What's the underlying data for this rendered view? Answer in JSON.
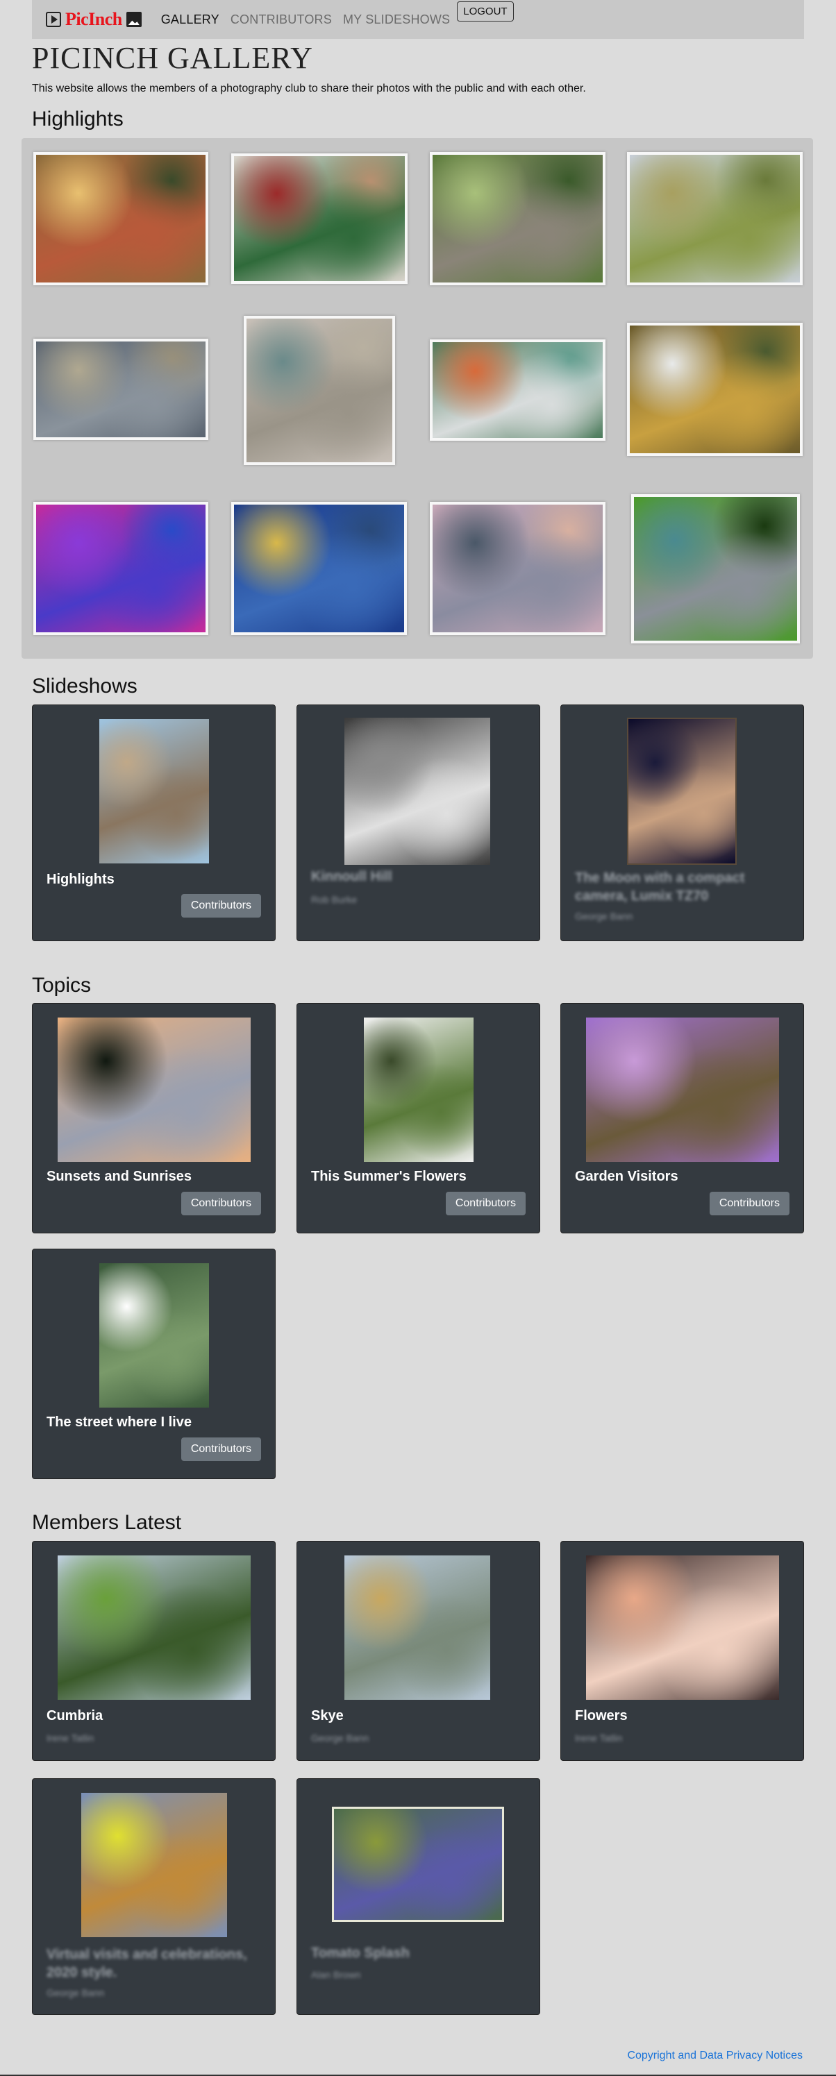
{
  "nav": {
    "brand": "PicInch",
    "links": [
      "GALLERY",
      "CONTRIBUTORS",
      "MY SLIDESHOWS"
    ],
    "logout": "LOGOUT"
  },
  "site": {
    "title": "PICINCH GALLERY",
    "intro": "This website allows the members of a photography club to share their photos with the public and with each other."
  },
  "sections": {
    "highlights": "Highlights",
    "slideshows": "Slideshows",
    "topics": "Topics",
    "members_latest": "Members Latest"
  },
  "highlights": [
    {
      "name": "steam-train-forest-photo",
      "colors": [
        "#8a6a3a",
        "#b85a3a",
        "#e8c070",
        "#3a4a2a"
      ]
    },
    {
      "name": "green-steam-locomotive-photo",
      "colors": [
        "#d9d4cc",
        "#2f6a3a",
        "#9c2a2a",
        "#b89070"
      ]
    },
    {
      "name": "stone-viaduct-photo",
      "colors": [
        "#5a7a3a",
        "#8a8478",
        "#a8c07a",
        "#3a5a2a"
      ]
    },
    {
      "name": "green-valley-rainbow-photo",
      "colors": [
        "#c8cfd8",
        "#8a9a4a",
        "#a8a060",
        "#6a7a3a"
      ]
    },
    {
      "name": "beach-storm-sky-photo",
      "colors": [
        "#5a6470",
        "#8a939c",
        "#b0a890",
        "#9a9078"
      ]
    },
    {
      "name": "concrete-dome-columns-photo",
      "colors": [
        "#c8c0b8",
        "#9a9488",
        "#6a8a8a",
        "#b8b0a0"
      ]
    },
    {
      "name": "pool-floats-photo",
      "colors": [
        "#4a7a5a",
        "#d8dcdc",
        "#d86a3a",
        "#5a9a8a"
      ]
    },
    {
      "name": "waterfall-autumn-photo",
      "colors": [
        "#6a5a2a",
        "#c8a040",
        "#e8eaea",
        "#4a5a30"
      ]
    },
    {
      "name": "pink-purple-bubbles-photo",
      "colors": [
        "#c82a9a",
        "#4a3ac8",
        "#8a3ad8",
        "#2a4ac8"
      ]
    },
    {
      "name": "blue-lake-reflection-photo",
      "colors": [
        "#1a3a8a",
        "#3a6ab8",
        "#d8b84a",
        "#2a4a7a"
      ]
    },
    {
      "name": "dusk-river-bridge-photo",
      "colors": [
        "#c8a8b8",
        "#8a8ca0",
        "#4a5868",
        "#d8b0a0"
      ]
    },
    {
      "name": "green-leaf-grey-door-photo",
      "colors": [
        "#4a9a2a",
        "#8a9098",
        "#4a8a90",
        "#1a3a10"
      ]
    }
  ],
  "slideshows": [
    {
      "title": "Highlights",
      "subtitle": "",
      "button": "Contributors",
      "blurred": false,
      "colors": [
        "#9fc4e0",
        "#8a7660",
        "#c0a888"
      ]
    },
    {
      "title": "Kinnoull Hill",
      "subtitle": "Rob Burke",
      "button": "",
      "blurred": true,
      "colors": [
        "#3a3a3a",
        "#e0e0e0",
        "#8a8a8a"
      ]
    },
    {
      "title": "The Moon with a compact camera, Lumix TZ70",
      "subtitle": "George Bann",
      "button": "",
      "blurred": true,
      "colors": [
        "#0a0a2a",
        "#c8a080",
        "#1a1a3a"
      ]
    }
  ],
  "topics": [
    {
      "title": "Sunsets and Sunrises",
      "button": "Contributors",
      "colors": [
        "#e8b080",
        "#9aa0b0",
        "#101810"
      ]
    },
    {
      "title": "This Summer's Flowers",
      "button": "Contributors",
      "colors": [
        "#f0f0f0",
        "#5a7a3a",
        "#3a4a2a"
      ]
    },
    {
      "title": "Garden Visitors",
      "button": "Contributors",
      "colors": [
        "#a070d0",
        "#6a5a3a",
        "#c89ad8"
      ]
    },
    {
      "title": "The street where I live",
      "button": "Contributors",
      "colors": [
        "#3a5a3a",
        "#7a9a6a",
        "#ffffff"
      ]
    }
  ],
  "members_latest": [
    {
      "title": "Cumbria",
      "subtitle": "Irene Tatlin",
      "blurred": false,
      "colors": [
        "#c0d0e0",
        "#3a5a2a",
        "#6aa03a"
      ]
    },
    {
      "title": "Skye",
      "subtitle": "George Bann",
      "blurred": false,
      "colors": [
        "#b8c8d8",
        "#7a8a7a",
        "#c8a860"
      ]
    },
    {
      "title": "Flowers",
      "subtitle": "Irene Tatlin",
      "blurred": false,
      "colors": [
        "#3a2a2a",
        "#f0d0c0",
        "#e8a888"
      ]
    },
    {
      "title": "Virtual visits and celebrations, 2020 style.",
      "subtitle": "George Bann",
      "blurred": true,
      "colors": [
        "#7a90b8",
        "#c08a3a",
        "#e0e030"
      ]
    },
    {
      "title": "Tomato Splash",
      "subtitle": "Alan Brown",
      "blurred": true,
      "colors": [
        "#4a6a4a",
        "#5a5aa8",
        "#8a9a3a"
      ]
    }
  ],
  "footer": {
    "link": "Copyright and Data Privacy Notices"
  }
}
